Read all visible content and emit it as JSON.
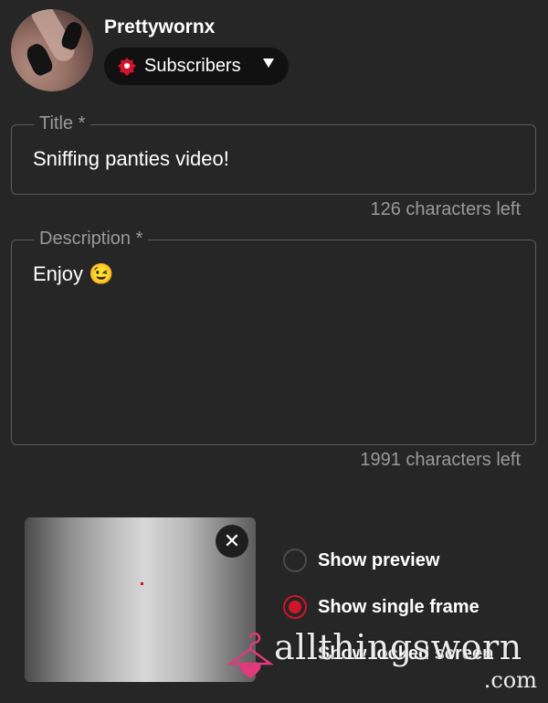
{
  "profile": {
    "username": "Prettywornx",
    "audience_label": "Subscribers"
  },
  "title_field": {
    "legend": "Title *",
    "value": "Sniffing panties video!",
    "counter": "126 characters left"
  },
  "description_field": {
    "legend": "Description *",
    "value": "Enjoy 😉",
    "counter": "1991 characters left"
  },
  "media": {
    "close_icon": "close-icon",
    "close_glyph": "✕"
  },
  "display_options": [
    {
      "label": "Show preview",
      "selected": false
    },
    {
      "label": "Show single frame",
      "selected": true
    },
    {
      "label": "Show locked screen",
      "selected": false
    }
  ],
  "watermark": {
    "text": "allthingsworn",
    "suffix": ".com"
  },
  "colors": {
    "background": "#262626",
    "accent": "#d0142c",
    "muted_text": "#9a9a9a",
    "border": "#5a5a5a"
  }
}
